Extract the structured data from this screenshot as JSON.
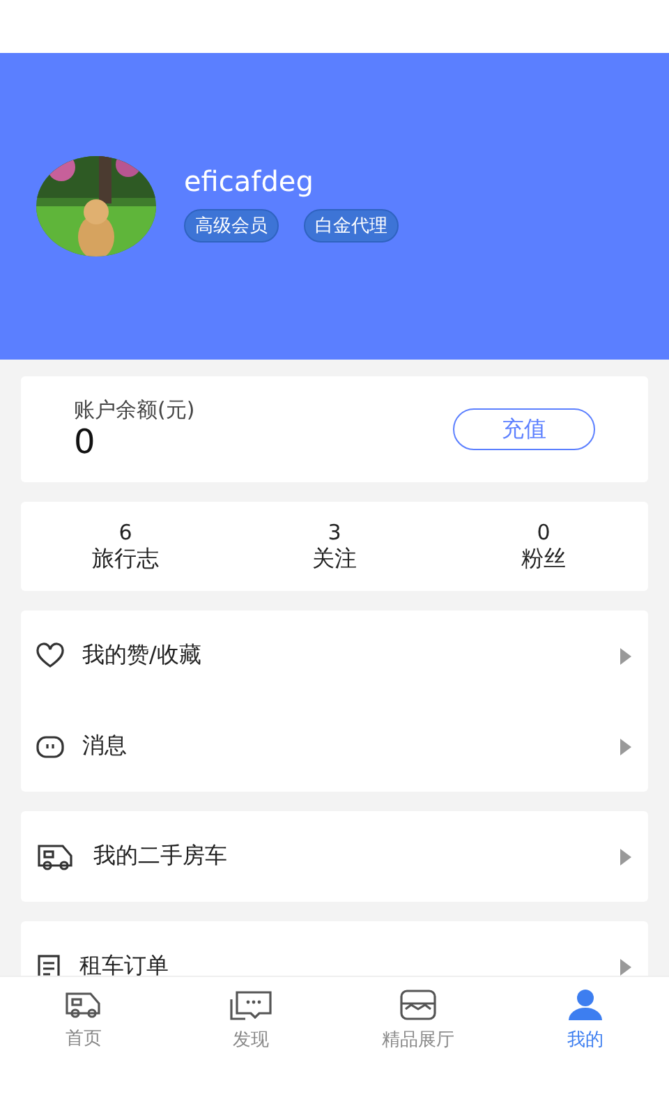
{
  "profile": {
    "username": "eficafdeg",
    "badges": [
      "高级会员",
      "白金代理"
    ]
  },
  "balance": {
    "label": "账户余额(元)",
    "amount": "0",
    "button": "充值"
  },
  "stats": [
    {
      "value": "6",
      "label": "旅行志"
    },
    {
      "value": "3",
      "label": "关注"
    },
    {
      "value": "0",
      "label": "粉丝"
    }
  ],
  "menu_groups": [
    [
      {
        "kind": "heart",
        "label": "我的赞/收藏"
      },
      {
        "kind": "message",
        "label": "消息"
      }
    ],
    [
      {
        "kind": "rv",
        "label": "我的二手房车"
      }
    ],
    [
      {
        "kind": "list",
        "label": "租车订单"
      }
    ]
  ],
  "tab_bar": [
    {
      "kind": "rv",
      "label": "首页",
      "selected": false
    },
    {
      "kind": "chat",
      "label": "发现",
      "selected": false
    },
    {
      "kind": "store",
      "label": "精品展厅",
      "selected": false
    },
    {
      "kind": "user",
      "label": "我的",
      "selected": true
    }
  ]
}
